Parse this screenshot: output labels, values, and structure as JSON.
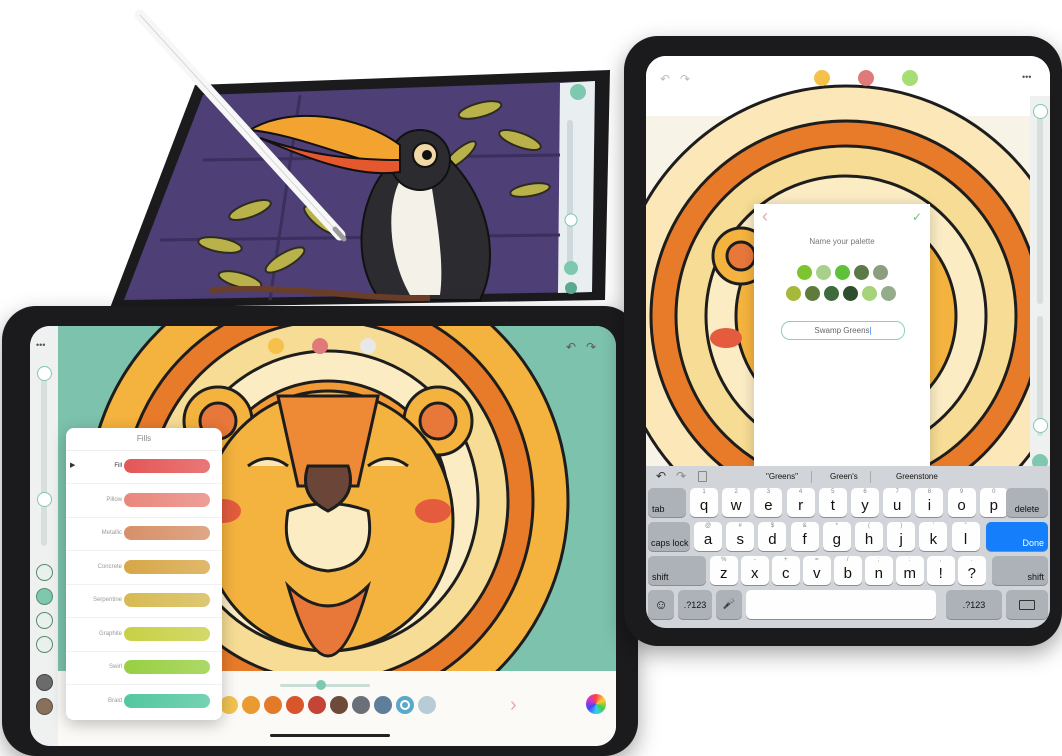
{
  "top_device": {
    "scene": "toucan illustration being colored with a stylus"
  },
  "left_device": {
    "menu_dots": "•••",
    "fills_panel": {
      "title": "Fills",
      "items": [
        {
          "label": "Fill",
          "color": "#e45656",
          "selected": true
        },
        {
          "label": "Pillow",
          "color": "#e9877c"
        },
        {
          "label": "Metallic",
          "color": "#d79068"
        },
        {
          "label": "Concrete",
          "color": "#d7a747"
        },
        {
          "label": "Serpentine",
          "color": "#d6ba52"
        },
        {
          "label": "Graphite",
          "color": "#c8d044"
        },
        {
          "label": "Swirl",
          "color": "#98cf42"
        },
        {
          "label": "Braid",
          "color": "#52c7a0"
        }
      ]
    },
    "palette": [
      "#f2c350",
      "#e99a30",
      "#e27a2a",
      "#d9552c",
      "#c44535",
      "#6d4a3a",
      "#6a6f78",
      "#5f7e9a",
      "#5aa9c9",
      "#b8ccd6"
    ],
    "next_arrow": "›"
  },
  "right_device": {
    "menu_dots": "•••",
    "dialog": {
      "title": "Name your palette",
      "input_value": "Swamp Greens",
      "back_icon": "‹",
      "confirm_icon": "✓",
      "swatches_row1": [
        "#7cc531",
        "#a8d08a",
        "#5fc13a",
        "#5a7a4a",
        "#8b9e80"
      ],
      "swatches_row2": [
        "#a8b83a",
        "#5e7a3c",
        "#3e6a3e",
        "#2e4e2e",
        "#a4d37a",
        "#93ad8c"
      ]
    },
    "keyboard": {
      "suggestions": [
        "\"Greens\"",
        "Green's",
        "Greenstone"
      ],
      "row1": [
        "q",
        "w",
        "e",
        "r",
        "t",
        "y",
        "u",
        "i",
        "o",
        "p"
      ],
      "row1_hints": [
        "1",
        "2",
        "3",
        "4",
        "5",
        "6",
        "7",
        "8",
        "9",
        "0"
      ],
      "row2": [
        "a",
        "s",
        "d",
        "f",
        "g",
        "h",
        "j",
        "k",
        "l"
      ],
      "row2_hints": [
        "@",
        "#",
        "$",
        "&",
        "*",
        "(",
        ")",
        "'",
        "\""
      ],
      "row3": [
        "z",
        "x",
        "c",
        "v",
        "b",
        "n",
        "m",
        "!",
        "?"
      ],
      "row3_hints": [
        "%",
        "-",
        "+",
        "=",
        "/",
        ";",
        ":",
        ",",
        "."
      ],
      "tab": "tab",
      "delete": "delete",
      "caps_lock": "caps lock",
      "done": "Done",
      "shift": "shift",
      "numbers": ".?123",
      "emoji": "☺",
      "mic": "🎤"
    }
  }
}
